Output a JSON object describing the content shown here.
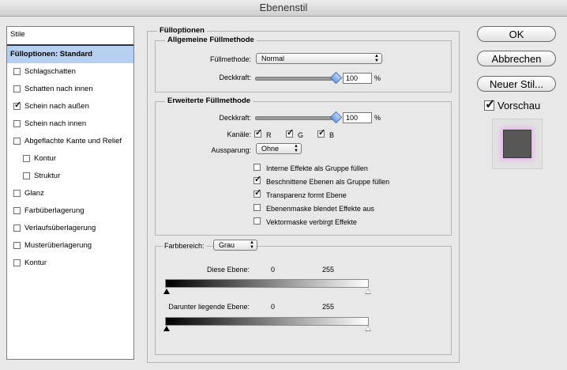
{
  "window": {
    "title": "Ebenenstil"
  },
  "sidebar": {
    "header": "Stile",
    "items": [
      {
        "label": "Fülloptionen: Standard",
        "checked": null,
        "selected": true,
        "indent": false
      },
      {
        "label": "Schlagschatten",
        "checked": false,
        "indent": false
      },
      {
        "label": "Schatten nach innen",
        "checked": false,
        "indent": false
      },
      {
        "label": "Schein nach außen",
        "checked": true,
        "indent": false
      },
      {
        "label": "Schein nach innen",
        "checked": false,
        "indent": false
      },
      {
        "label": "Abgeflachte Kante und Relief",
        "checked": false,
        "indent": false
      },
      {
        "label": "Kontur",
        "checked": false,
        "indent": true
      },
      {
        "label": "Struktur",
        "checked": false,
        "indent": true
      },
      {
        "label": "Glanz",
        "checked": false,
        "indent": false
      },
      {
        "label": "Farbüberlagerung",
        "checked": false,
        "indent": false
      },
      {
        "label": "Verlaufsüberlagerung",
        "checked": false,
        "indent": false
      },
      {
        "label": "Musterüberlagerung",
        "checked": false,
        "indent": false
      },
      {
        "label": "Kontur",
        "checked": false,
        "indent": false
      }
    ]
  },
  "fill_options": {
    "title": "Fülloptionen",
    "general": {
      "title": "Allgemeine Füllmethode",
      "blend_mode_label": "Füllmethode:",
      "blend_mode_value": "Normal",
      "opacity_label": "Deckkraft:",
      "opacity_value": "100",
      "opacity_unit": "%",
      "opacity_fraction": 1.0
    },
    "advanced": {
      "title": "Erweiterte Füllmethode",
      "fill_opacity_label": "Deckkraft:",
      "fill_opacity_value": "100",
      "fill_opacity_unit": "%",
      "fill_opacity_fraction": 1.0,
      "channels_label": "Kanäle:",
      "channel_r": "R",
      "channel_g": "G",
      "channel_b": "B",
      "knockout_label": "Aussparung:",
      "knockout_value": "Ohne",
      "options": [
        {
          "label": "Interne Effekte als Gruppe füllen",
          "checked": false
        },
        {
          "label": "Beschnittene Ebenen als Gruppe füllen",
          "checked": true
        },
        {
          "label": "Transparenz formt Ebene",
          "checked": true
        },
        {
          "label": "Ebenenmaske blendet Effekte aus",
          "checked": false
        },
        {
          "label": "Vektormaske verbirgt Effekte",
          "checked": false
        }
      ]
    },
    "blend_if": {
      "label": "Farbbereich:",
      "value": "Grau",
      "this_layer_label": "Diese Ebene:",
      "this_layer_low": "0",
      "this_layer_high": "255",
      "underlying_label": "Darunter liegende Ebene:",
      "underlying_low": "0",
      "underlying_high": "255"
    }
  },
  "buttons": {
    "ok": "OK",
    "reset": "Abbrechen",
    "new_style": "Neuer Stil...",
    "preview_label": "Vorschau",
    "preview_checked": true
  },
  "colors": {
    "selection": "#b6d0f2",
    "glow": "#e8b8ea",
    "swatch": "#575757"
  }
}
